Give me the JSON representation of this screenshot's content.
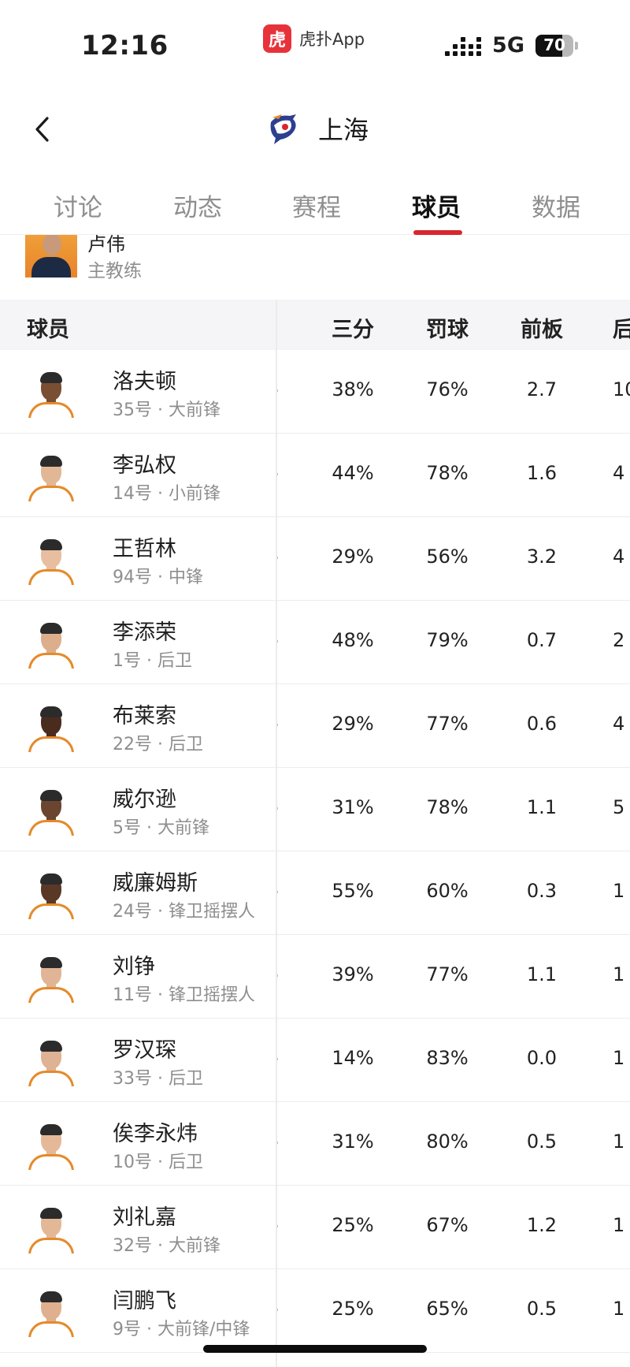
{
  "status_bar": {
    "time": "12:16",
    "app_logo_glyph": "虎",
    "app_name": "虎扑App",
    "network": "5G",
    "battery": "70",
    "battery_level": 0.7
  },
  "nav": {
    "back_icon": "chevron-left-icon",
    "team_logo_icon": "shanghai-sharks-logo",
    "title": "上海"
  },
  "tabs": [
    {
      "label": "讨论",
      "active": false
    },
    {
      "label": "动态",
      "active": false
    },
    {
      "label": "赛程",
      "active": false
    },
    {
      "label": "球员",
      "active": true
    },
    {
      "label": "数据",
      "active": false
    }
  ],
  "coach": {
    "name": "卢伟",
    "role": "主教练"
  },
  "table": {
    "headers": {
      "player": "球员",
      "three": "三分",
      "ft": "罚球",
      "oreb": "前板",
      "dreb": "后"
    },
    "rows": [
      {
        "name": "洛夫顿",
        "meta": "35号 · 大前锋",
        "three": "38%",
        "ft": "76%",
        "oreb": "2.7",
        "dreb": "10",
        "skin": "#7a4e32",
        "jersey": "#e58a2a"
      },
      {
        "name": "李弘权",
        "meta": "14号 · 小前锋",
        "three": "44%",
        "ft": "78%",
        "oreb": "1.6",
        "dreb": "4",
        "skin": "#e2b796",
        "jersey": "#e58a2a"
      },
      {
        "name": "王哲林",
        "meta": "94号 · 中锋",
        "three": "29%",
        "ft": "56%",
        "oreb": "3.2",
        "dreb": "4",
        "skin": "#e7bea0",
        "jersey": "#e58a2a"
      },
      {
        "name": "李添荣",
        "meta": "1号 · 后卫",
        "three": "48%",
        "ft": "79%",
        "oreb": "0.7",
        "dreb": "2",
        "skin": "#dcae8c",
        "jersey": "#e58a2a"
      },
      {
        "name": "布莱索",
        "meta": "22号 · 后卫",
        "three": "29%",
        "ft": "77%",
        "oreb": "0.6",
        "dreb": "4",
        "skin": "#4a2c1f",
        "jersey": "#e58a2a"
      },
      {
        "name": "威尔逊",
        "meta": "5号 · 大前锋",
        "three": "31%",
        "ft": "78%",
        "oreb": "1.1",
        "dreb": "5",
        "skin": "#6b4530",
        "jersey": "#e58a2a"
      },
      {
        "name": "威廉姆斯",
        "meta": "24号 · 锋卫摇摆人",
        "three": "55%",
        "ft": "60%",
        "oreb": "0.3",
        "dreb": "1",
        "skin": "#5a3826",
        "jersey": "#e58a2a"
      },
      {
        "name": "刘铮",
        "meta": "11号 · 锋卫摇摆人",
        "three": "39%",
        "ft": "77%",
        "oreb": "1.1",
        "dreb": "1",
        "skin": "#e0b494",
        "jersey": "#e58a2a"
      },
      {
        "name": "罗汉琛",
        "meta": "33号 · 后卫",
        "three": "14%",
        "ft": "83%",
        "oreb": "0.0",
        "dreb": "1",
        "skin": "#deb292",
        "jersey": "#e58a2a"
      },
      {
        "name": "俟李永炜",
        "meta": "10号 · 后卫",
        "three": "31%",
        "ft": "80%",
        "oreb": "0.5",
        "dreb": "1",
        "skin": "#e5b998",
        "jersey": "#e58a2a"
      },
      {
        "name": "刘礼嘉",
        "meta": "32号 · 大前锋",
        "three": "25%",
        "ft": "67%",
        "oreb": "1.2",
        "dreb": "1",
        "skin": "#e3b897",
        "jersey": "#e58a2a"
      },
      {
        "name": "闫鹏飞",
        "meta": "9号 · 大前锋/中锋",
        "three": "25%",
        "ft": "65%",
        "oreb": "0.5",
        "dreb": "1",
        "skin": "#dfb08e",
        "jersey": "#e58a2a"
      }
    ]
  }
}
